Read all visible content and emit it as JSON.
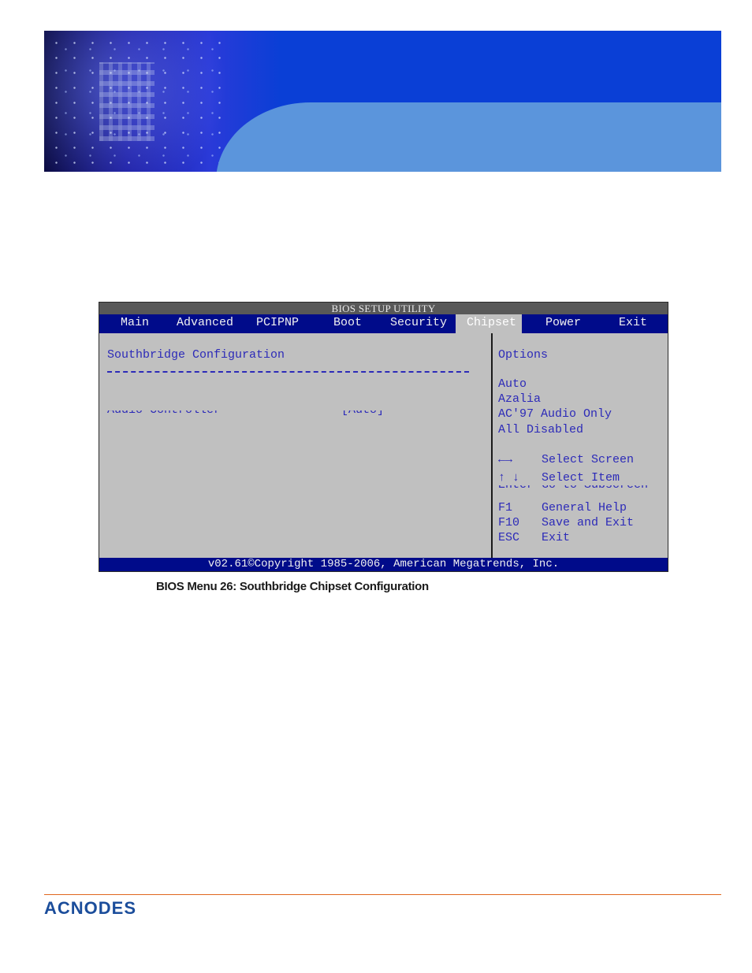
{
  "bios": {
    "title": "BIOS SETUP UTILITY",
    "tabs": [
      {
        "label": "Main",
        "active": false
      },
      {
        "label": "Advanced",
        "active": false
      },
      {
        "label": "PCIPNP",
        "active": false
      },
      {
        "label": "Boot",
        "active": false
      },
      {
        "label": "Security",
        "active": false
      },
      {
        "label": "Chipset",
        "active": true
      },
      {
        "label": "Power",
        "active": false
      },
      {
        "label": "Exit",
        "active": false
      }
    ],
    "section_title": "Southbridge Configuration",
    "settings": [
      {
        "label": "Audio Controller",
        "value": "[Auto]"
      }
    ],
    "options_heading": "Options",
    "options": [
      "Auto",
      "Azalia",
      "AC'97 Audio Only",
      "All Disabled"
    ],
    "help": [
      {
        "key": "←→",
        "icon": "arrows-left-right-icon",
        "desc": "Select Screen"
      },
      {
        "key": "↑ ↓",
        "icon": "arrows-up-down-icon",
        "desc": "Select Item"
      },
      {
        "key": "Enter",
        "desc": "Go to Subscreen"
      },
      {
        "key": "F1",
        "desc": "General Help"
      },
      {
        "key": "F10",
        "desc": "Save and Exit"
      },
      {
        "key": "ESC",
        "desc": "Exit"
      }
    ],
    "footer": "v02.61©Copyright 1985-2006, American Megatrends, Inc.",
    "colors": {
      "nav_bg": "#000b8a",
      "panel_bg": "#c0c0c0",
      "text": "#2c2ab8",
      "title_bar": "#585858"
    }
  },
  "caption": "BIOS Menu 26: Southbridge Chipset Configuration",
  "footer": {
    "logo_text": "ACNODES",
    "rule_color": "#e0661e"
  }
}
